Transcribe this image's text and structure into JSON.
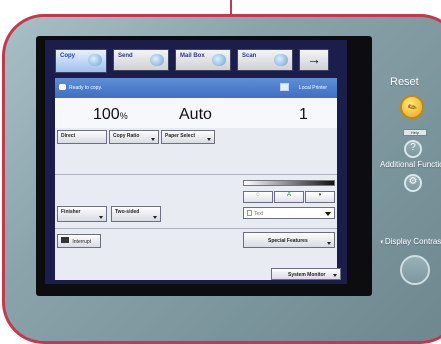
{
  "tabs": [
    {
      "label": "Copy",
      "active": true,
      "icon": "copier-icon"
    },
    {
      "label": "Send",
      "active": false,
      "icon": "send-icon"
    },
    {
      "label": "Mail Box",
      "active": false,
      "icon": "mailbox-icon"
    },
    {
      "label": "Scan",
      "active": false,
      "icon": "scan-icon"
    },
    {
      "label": "→",
      "active": false,
      "icon": "arrow-right-icon"
    }
  ],
  "status": {
    "message": "Ready to copy.",
    "printer": "Local Printer"
  },
  "copy": {
    "ratio": "100",
    "ratio_unit": "%",
    "paper": "Auto",
    "count": "1"
  },
  "buttons": {
    "direct": "Direct",
    "copy_ratio": "Copy Ratio",
    "paper_select": "Paper Select",
    "finisher": "Finisher",
    "two_sided": "Two-sided",
    "interrupt": "Interrupt",
    "special_features": "Special Features",
    "system_monitor": "System Monitor"
  },
  "density": {
    "light_symbol": "◌",
    "auto_label": "A",
    "dark_symbol": "◗",
    "original_type": "Text"
  },
  "right_panel": {
    "reset": "Reset",
    "help": "Help",
    "additional_functions": "Additional Functions",
    "display_contrast": "Display Contrast"
  },
  "colors": {
    "frame_accent": "#c43a4a",
    "panel_bg": "#8aa3ab",
    "screen_bg": "#1b1d4a",
    "status_bar": "#4a7bcc",
    "reset_button": "#f1c232"
  }
}
